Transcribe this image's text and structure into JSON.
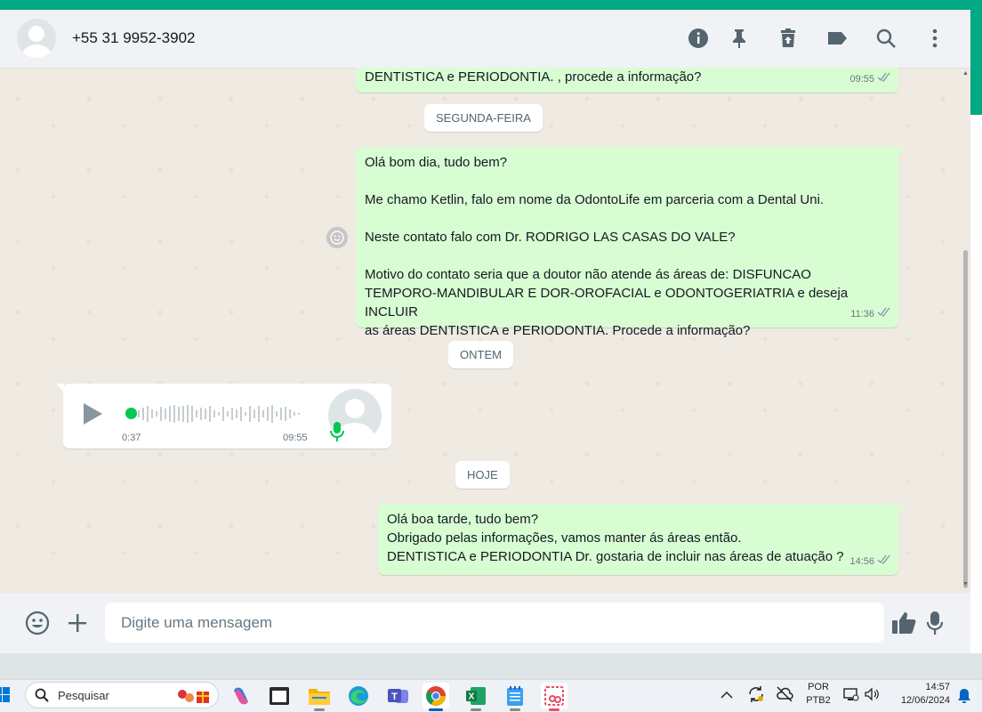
{
  "header": {
    "contact_name": "+55 31 9952-3902",
    "icons": [
      "info-icon",
      "pin-icon",
      "delete-icon",
      "label-icon",
      "search-icon",
      "menu-icon"
    ]
  },
  "messages": {
    "m1": {
      "text": "DENTISTICA e PERIODONTIA. , procede a informação?",
      "time": "09:55"
    },
    "date1": "SEGUNDA-FEIRA",
    "m2": {
      "text": "Olá bom dia, tudo bem?\n\nMe chamo Ketlin, falo em nome da OdontoLife em parceria com a Dental Uni.\n\nNeste contato falo com Dr. RODRIGO LAS CASAS DO VALE?\n\nMotivo do contato seria que a doutor não atende ás áreas de: DISFUNCAO\nTEMPORO-MANDIBULAR E DOR-OROFACIAL e ODONTOGERIATRIA e deseja INCLUIR\nas áreas DENTISTICA e PERIODONTIA. Procede a informação?",
      "time": "11:36"
    },
    "date2": "ONTEM",
    "audio": {
      "duration": "0:37",
      "time": "09:55",
      "progress": 0
    },
    "date3": "HOJE",
    "m3": {
      "text": "Olá boa tarde, tudo bem?\nObrigado pelas informações, vamos manter ás áreas então.\nDENTISTICA e PERIODONTIA Dr. gostaria de incluir nas áreas de atuação ?",
      "time": "14:56"
    }
  },
  "composer": {
    "placeholder": "Digite uma mensagem"
  },
  "taskbar": {
    "search_label": "Pesquisar",
    "lang_top": "POR",
    "lang_bottom": "PTB2",
    "time": "14:57",
    "date": "12/06/2024"
  },
  "colors": {
    "accent": "#00a884",
    "outgoing_bubble": "#d9fdd3",
    "chat_background": "#efeae2"
  }
}
